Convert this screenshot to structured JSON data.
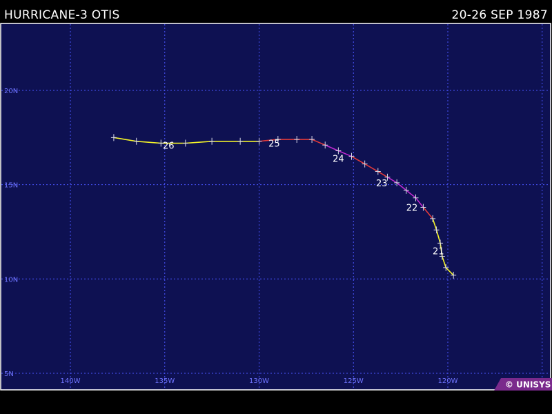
{
  "header": {
    "title": "HURRICANE-3 OTIS",
    "date_range": "20-26 SEP 1987"
  },
  "colors": {
    "ocean": "#0e1152",
    "grid": "#4a55ff",
    "axis_label": "#6f74ff",
    "frame": "#ffffff",
    "track_yellow": "#f5f528",
    "track_red": "#e23a3a",
    "track_magenta": "#c02ad0",
    "day_label": "#ffffff",
    "logo_bg": "#7a2a8c"
  },
  "map": {
    "lat_labels": [
      "20N",
      "15N",
      "10N",
      "5N"
    ],
    "lon_labels": [
      "140W",
      "135W",
      "130W",
      "125W",
      "120W"
    ],
    "credit": "© UNISYS"
  },
  "chart_data": {
    "type": "track",
    "legend_note": "color = intensity (yellow = storm, red = hurricane cat 1, magenta = cat 2/3)",
    "day_labels": [
      {
        "text": "21",
        "lon": -120.5,
        "lat": 11.5
      },
      {
        "text": "22",
        "lon": -121.9,
        "lat": 13.8
      },
      {
        "text": "23",
        "lon": -123.5,
        "lat": 15.1
      },
      {
        "text": "24",
        "lon": -125.8,
        "lat": 16.4
      },
      {
        "text": "25",
        "lon": -129.2,
        "lat": 17.2
      },
      {
        "text": "26",
        "lon": -134.8,
        "lat": 17.1
      }
    ],
    "track": [
      {
        "lon": -119.7,
        "lat": 10.2,
        "cat": "storm"
      },
      {
        "lon": -120.1,
        "lat": 10.6,
        "cat": "storm"
      },
      {
        "lon": -120.3,
        "lat": 11.2,
        "cat": "storm"
      },
      {
        "lon": -120.4,
        "lat": 11.9,
        "cat": "storm"
      },
      {
        "lon": -120.6,
        "lat": 12.6,
        "cat": "storm"
      },
      {
        "lon": -120.8,
        "lat": 13.2,
        "cat": "storm"
      },
      {
        "lon": -121.3,
        "lat": 13.8,
        "cat": "hur1"
      },
      {
        "lon": -121.7,
        "lat": 14.3,
        "cat": "hur2"
      },
      {
        "lon": -122.2,
        "lat": 14.7,
        "cat": "hur2"
      },
      {
        "lon": -122.7,
        "lat": 15.1,
        "cat": "hur2"
      },
      {
        "lon": -123.2,
        "lat": 15.4,
        "cat": "hur2"
      },
      {
        "lon": -123.7,
        "lat": 15.7,
        "cat": "hur1"
      },
      {
        "lon": -124.4,
        "lat": 16.1,
        "cat": "hur1"
      },
      {
        "lon": -125.1,
        "lat": 16.5,
        "cat": "hur1"
      },
      {
        "lon": -125.8,
        "lat": 16.8,
        "cat": "hur2"
      },
      {
        "lon": -126.5,
        "lat": 17.1,
        "cat": "hur2"
      },
      {
        "lon": -127.2,
        "lat": 17.4,
        "cat": "hur1"
      },
      {
        "lon": -128.0,
        "lat": 17.4,
        "cat": "hur1"
      },
      {
        "lon": -129.0,
        "lat": 17.4,
        "cat": "hur1"
      },
      {
        "lon": -130.0,
        "lat": 17.3,
        "cat": "hur1"
      },
      {
        "lon": -131.0,
        "lat": 17.3,
        "cat": "storm"
      },
      {
        "lon": -132.5,
        "lat": 17.3,
        "cat": "storm"
      },
      {
        "lon": -133.9,
        "lat": 17.2,
        "cat": "storm"
      },
      {
        "lon": -135.2,
        "lat": 17.2,
        "cat": "storm"
      },
      {
        "lon": -136.5,
        "lat": 17.3,
        "cat": "storm"
      },
      {
        "lon": -137.7,
        "lat": 17.5,
        "cat": "storm"
      }
    ]
  }
}
